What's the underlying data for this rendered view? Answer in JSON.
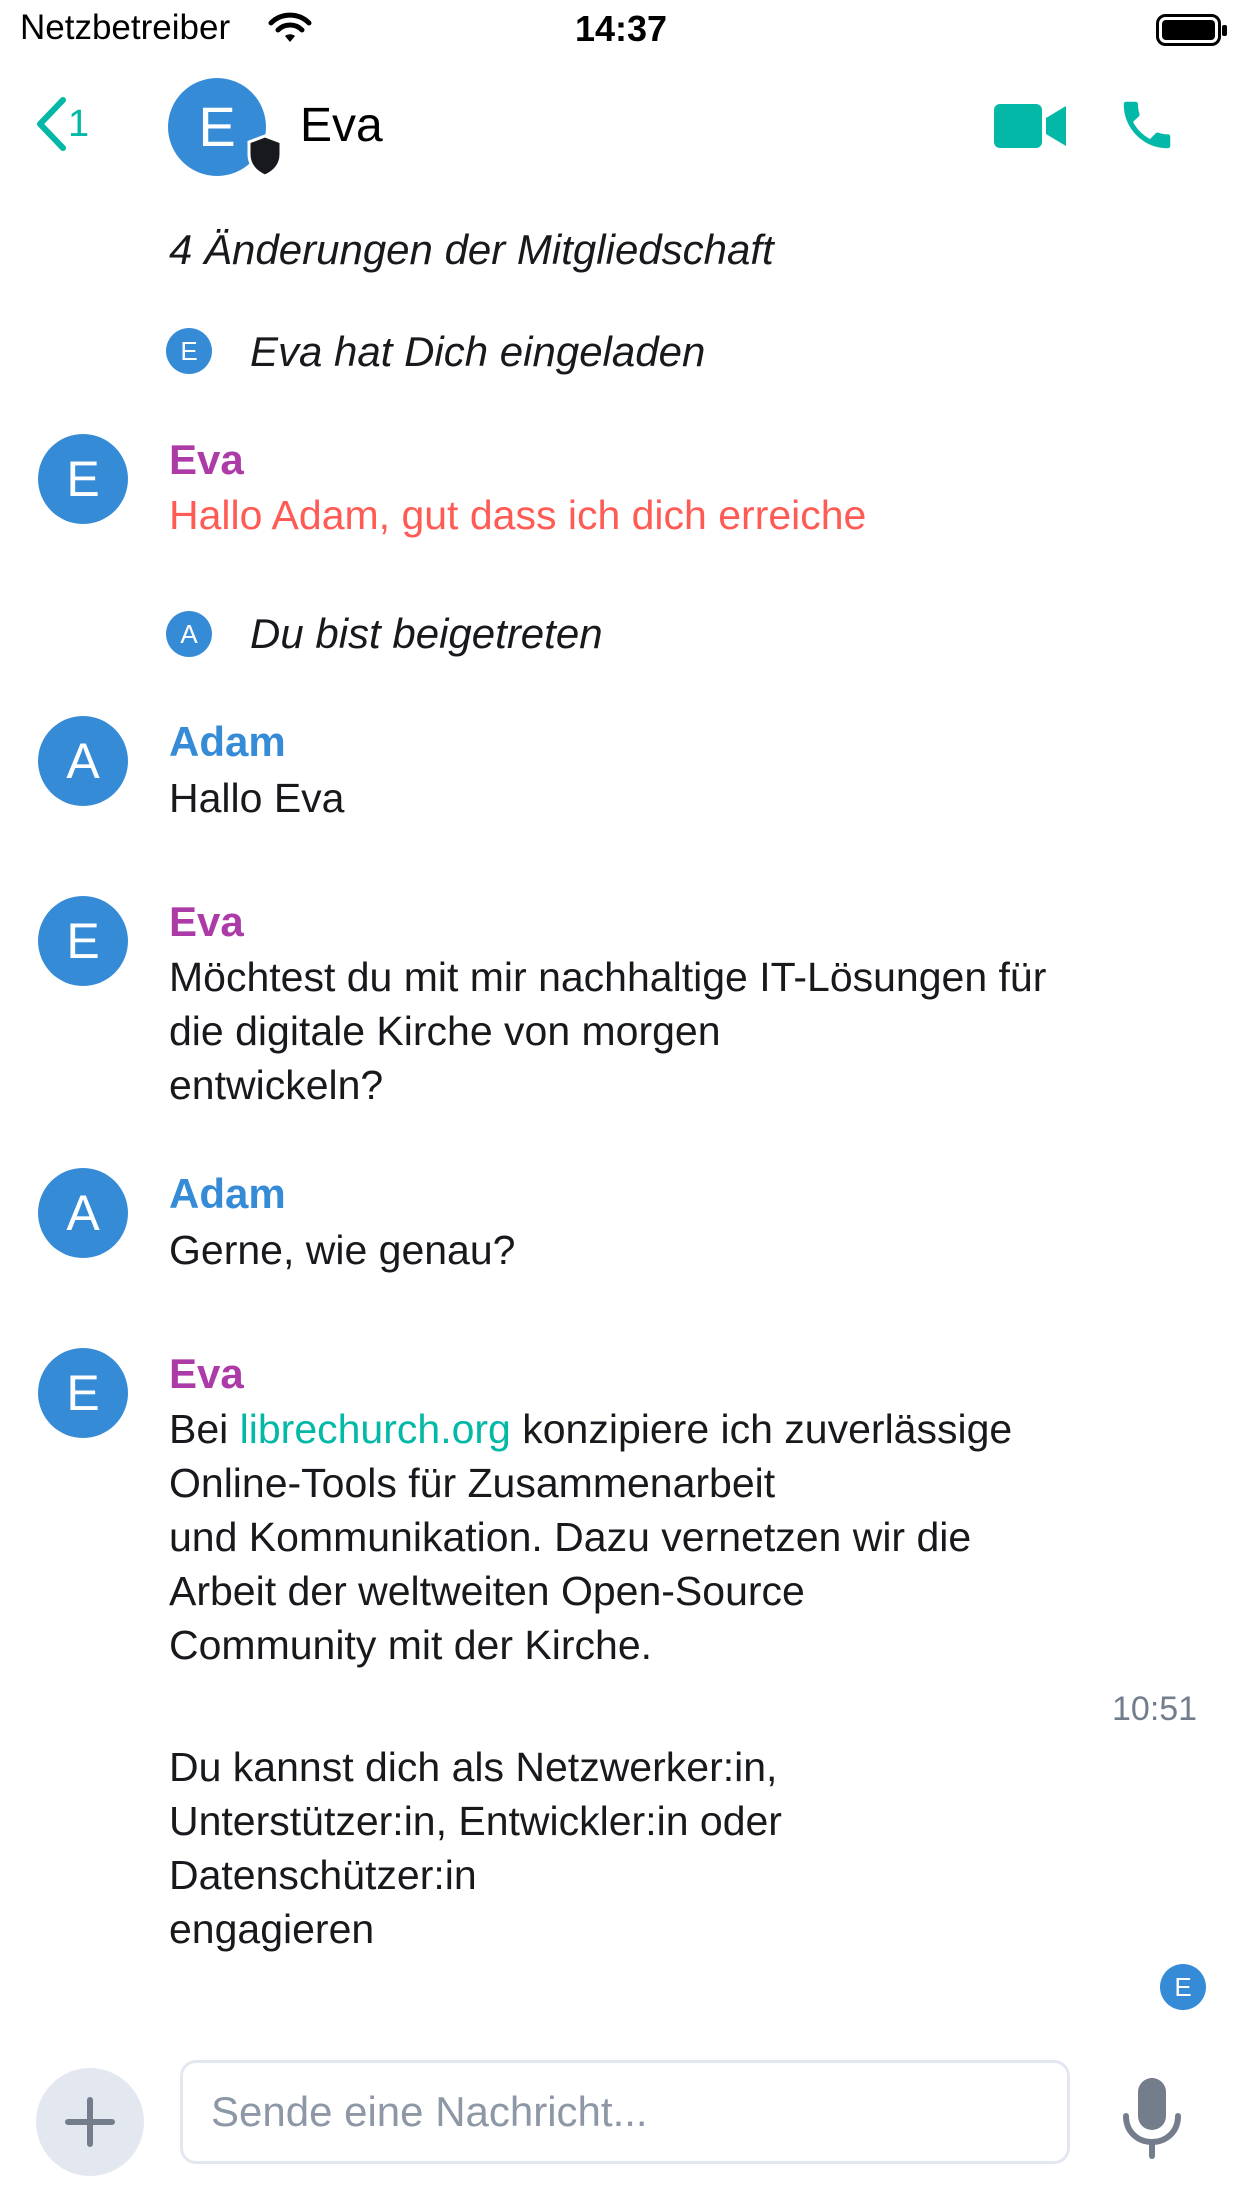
{
  "status_bar": {
    "carrier": "Netzbetreiber",
    "time": "14:37"
  },
  "header": {
    "back_count": "1",
    "room_avatar_letter": "E",
    "room_name": "Eva"
  },
  "timeline": {
    "membership_summary": "4 Änderungen der Mitgliedschaft",
    "invite_event": {
      "avatar_letter": "E",
      "text": "Eva hat Dich eingeladen"
    },
    "msg1": {
      "avatar_letter": "E",
      "sender": "Eva",
      "text": "Hallo Adam, gut dass ich dich erreiche"
    },
    "join_event": {
      "avatar_letter": "A",
      "text": "Du bist beigetreten"
    },
    "msg2": {
      "avatar_letter": "A",
      "sender": "Adam",
      "text": "Hallo Eva"
    },
    "msg3": {
      "avatar_letter": "E",
      "sender": "Eva",
      "lines": [
        "Möchtest du mit mir nachhaltige IT-Lösungen für",
        "die digitale Kirche von morgen",
        "entwickeln?"
      ]
    },
    "msg4": {
      "avatar_letter": "A",
      "sender": "Adam",
      "text": "Gerne, wie genau?"
    },
    "msg5": {
      "avatar_letter": "E",
      "sender": "Eva",
      "prefix": "Bei ",
      "link": "librechurch.org",
      "suffix": " konzipiere ich zuverlässige",
      "lines": [
        "Online-Tools für Zusammenarbeit",
        "und Kommunikation. Dazu vernetzen wir die",
        "Arbeit der weltweiten Open-Source",
        "Community mit der Kirche."
      ],
      "timestamp": "10:51"
    },
    "msg6": {
      "lines": [
        "Du kannst dich als Netzwerker:in,",
        "Unterstützer:in, Entwickler:in oder",
        "Datenschützer:in",
        "engagieren"
      ]
    },
    "read_receipt": "E"
  },
  "composer": {
    "placeholder": "Sende eine Nachricht..."
  },
  "colors": {
    "accent": "#03b8a6",
    "avatar": "#368bd6",
    "eva": "#ac3ba8",
    "adam": "#368bd6",
    "highlight": "#ff5b55"
  }
}
